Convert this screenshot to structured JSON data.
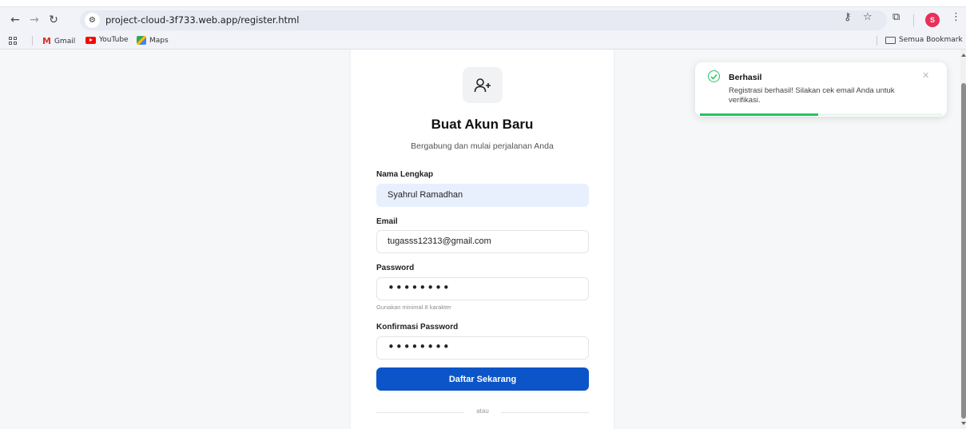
{
  "browser": {
    "url": "project-cloud-3f733.web.app/register.html",
    "profile_initial": "S",
    "bookmarks": [
      {
        "label": "Gmail",
        "icon": "gmail-icon"
      },
      {
        "label": "YouTube",
        "icon": "youtube-icon"
      },
      {
        "label": "Maps",
        "icon": "maps-icon"
      }
    ],
    "all_bookmarks_label": "Semua Bookmark"
  },
  "form": {
    "icon": "user-plus-icon",
    "title": "Buat Akun Baru",
    "subtitle": "Bergabung dan mulai perjalanan Anda",
    "name_label": "Nama Lengkap",
    "name_value": "Syahrul Ramadhan",
    "email_label": "Email",
    "email_value": "tugasss12313@gmail.com",
    "password_label": "Password",
    "password_value": "••••••••",
    "password_hint": "Gunakan minimal 8 karakter",
    "confirm_label": "Konfirmasi Password",
    "confirm_value": "••••••••",
    "submit_label": "Daftar Sekarang",
    "divider_text": "atau"
  },
  "toast": {
    "title": "Berhasil",
    "message": "Registrasi berhasil! Silakan cek email Anda untuk verifikasi.",
    "close": "✕",
    "progress_fraction": 0.49,
    "accent": "#22c55e"
  },
  "colors": {
    "primary_button": "#0b55c9",
    "profile": "#e8305a"
  }
}
